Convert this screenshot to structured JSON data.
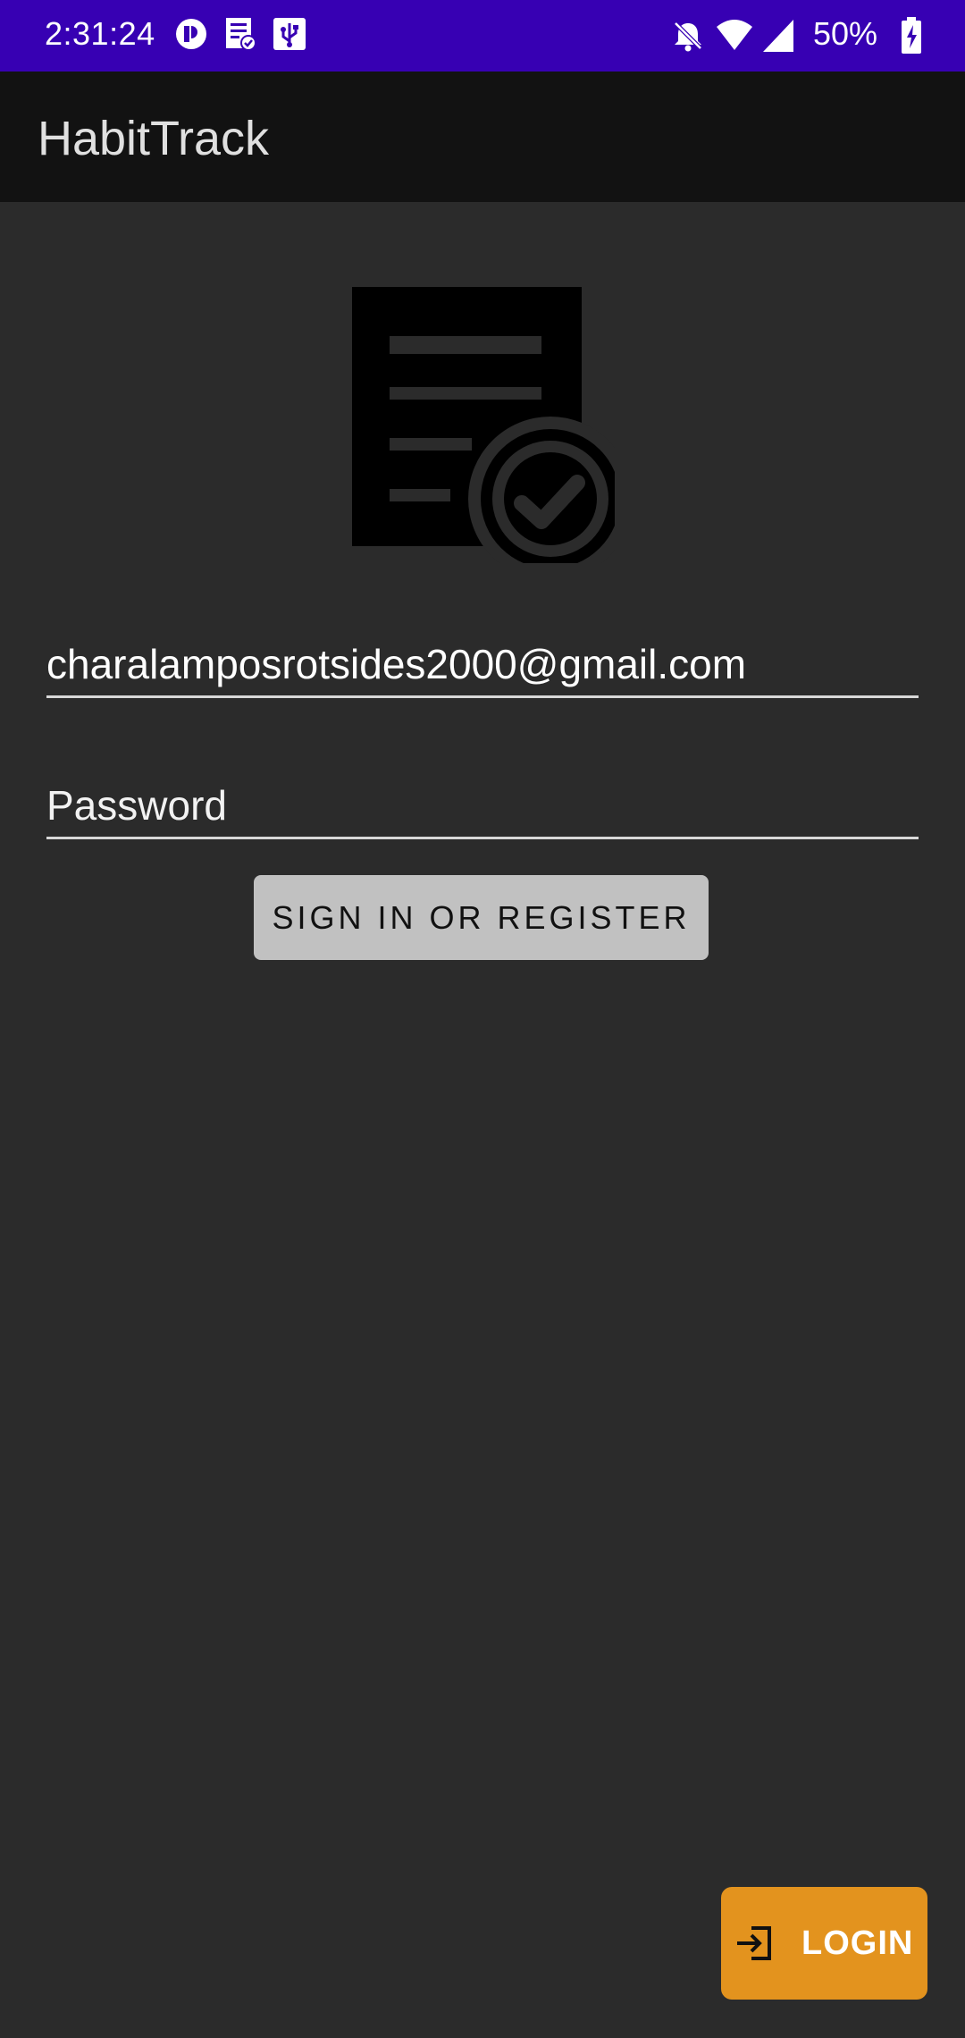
{
  "status_bar": {
    "time": "2:31:24",
    "battery_percent": "50%",
    "left_icons": [
      "sync-status-icon",
      "task-list-icon",
      "usb-icon"
    ],
    "right_icons": [
      "notifications-off-icon",
      "wifi-icon",
      "cellular-signal-icon",
      "battery-charging-icon"
    ],
    "background_color": "#3700b3"
  },
  "app_bar": {
    "title": "HabitTrack"
  },
  "logo": {
    "icon": "task-document-check-icon"
  },
  "form": {
    "email_value": "charalamposrotsides2000@gmail.com",
    "password_placeholder": "Password",
    "submit_label": "SIGN IN OR REGISTER"
  },
  "fab": {
    "label": "LOGIN",
    "icon": "login-arrow-icon",
    "color": "#e3931e"
  }
}
